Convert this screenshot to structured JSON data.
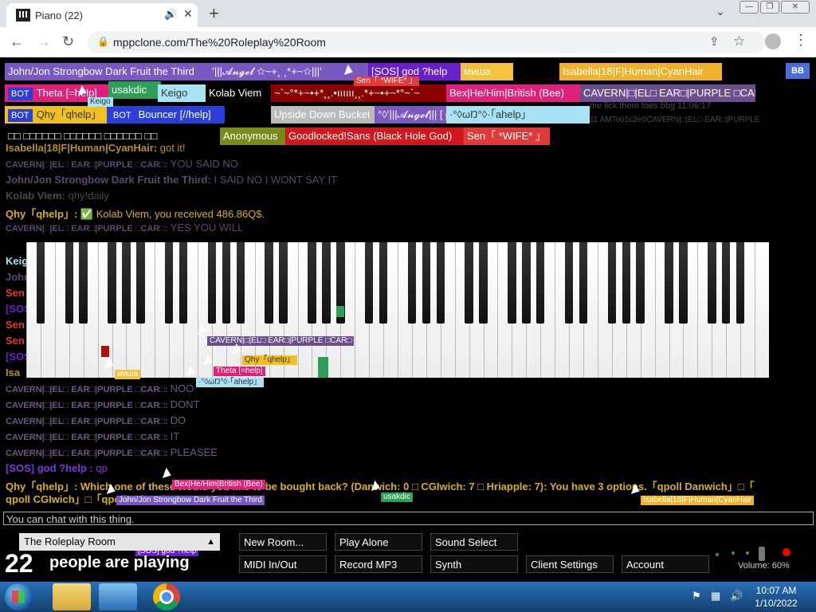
{
  "browser": {
    "tab_title": "Piano (22)",
    "url": "mppclone.com/The%20Roleplay%20Room"
  },
  "participants": [
    {
      "label": "John/Jon Strongbow Dark Fruit the Third",
      "bg": "#7a58c2",
      "fg": "#ffffff"
    },
    {
      "label": "ʻ|||𝓐𝓷𝓰𝓮𝓵 ☆~+¸ ¸*+~☆|||ʻ",
      "bg": "#7a58c2",
      "fg": "#ffffff"
    },
    {
      "label": "[SOS] god ?help",
      "bg": "#6a1fcc",
      "fg": "#ffffff"
    },
    {
      "label": "миша",
      "bg": "#f3c13a",
      "fg": "#ffffff"
    },
    {
      "label": "Isabella|18|F|Human|CyanHair",
      "bg": "#f0b22a",
      "fg": "#ffffff"
    },
    {
      "label": "Theta [=help]",
      "bg": "#e0207a",
      "fg": "#ffffff",
      "bot": true
    },
    {
      "label": "usakdic",
      "bg": "#2e9e58",
      "fg": "#ffffff"
    },
    {
      "label": "Keigo",
      "bg": "#a8e2f5",
      "fg": "#333333"
    },
    {
      "label": "Kolab Viem",
      "bg": "#000000",
      "fg": "#ffffff"
    },
    {
      "label": "~`~°*+~•+*¸¸.•ıııııı¸¸.*+~•+~*°~`~",
      "bg": "#8b0000",
      "fg": "#ffffff"
    },
    {
      "label": "Bex|He/Him|British (Bee)",
      "bg": "#e0207a",
      "fg": "#ffffff"
    },
    {
      "label": "CAVERN|□|EL□ EAR□|PURPLE □CAR□",
      "bg": "#6b4f8c",
      "fg": "#ffffff"
    },
    {
      "label": "Qhy「qhelp」",
      "bg": "#f0c020",
      "fg": "#333333",
      "bot": true
    },
    {
      "label": "Bouncer [//help]",
      "bg": "#2a3fd6",
      "fg": "#ffffff",
      "bot": true
    },
    {
      "label": "Upside Down Bucket",
      "bg": "#bbbbbb",
      "fg": "#ffffff"
    },
    {
      "label": "°◊ʻ|||𝓐𝓷𝓰𝓮𝓵||| [🔒]",
      "bg": "#7a58c2",
      "fg": "#ffffff"
    },
    {
      "label": "·°◊ωŊ°◊·「ahelp」",
      "bg": "#a8e2f5",
      "fg": "#333333"
    },
    {
      "label": "□□ □□□□□□ □□□□□□ □□□□□□ □□",
      "bg": "#000000",
      "fg": "#ffffff"
    },
    {
      "label": "Anonymous",
      "bg": "#7a8a1a",
      "fg": "#ffffff"
    },
    {
      "label": "Goodlocked!Sans (Black Hole God)",
      "bg": "#d2181e",
      "fg": "#ffffff"
    },
    {
      "label": "Sen「 *WIFE* 」",
      "bg": "#e03a3a",
      "fg": "#ffffff"
    }
  ],
  "toolbar_chip": "BB",
  "chat": [
    {
      "name": "Isabella|18|F|Human|CyanHair:",
      "text": "got it!",
      "color": "#b5902a"
    },
    {
      "name": "CAVERN|□|EL□ EAR□|PURPLE □CAR□:",
      "text": "YOU SAID NO",
      "color": "#5a4a6e",
      "sc": true
    },
    {
      "name": "John/Jon Strongbow Dark Fruit the Third:",
      "text": "I SAID NO I WONT SAY IT",
      "color": "#5a4a6e"
    },
    {
      "name": "Kolab Viem:",
      "text": "qhy!daily",
      "color": "#4a4a4a"
    },
    {
      "name": "Qhy「qhelp」:",
      "text": "✅ Kolab Viem, you received 486.86Q$.",
      "color": "#d8b020"
    },
    {
      "name": "CAVERN|□|EL□ EAR□|PURPLE □CAR□:",
      "text": "YES YOU WILL",
      "color": "#5a4a6e",
      "sc": true
    }
  ],
  "chat_lower": [
    {
      "name": "CAVERN|□|EL□ EAR□|PURPLE □CAR□:",
      "text": "NOO",
      "color": "#6b5a80",
      "sc": true
    },
    {
      "name": "CAVERN|□|EL□ EAR□|PURPLE □CAR□:",
      "text": "DONT",
      "color": "#6b5a80",
      "sc": true
    },
    {
      "name": "CAVERN|□|EL□ EAR□|PURPLE □CAR□:",
      "text": "DO",
      "color": "#6b5a80",
      "sc": true
    },
    {
      "name": "CAVERN|□|EL□ EAR□|PURPLE □CAR□:",
      "text": "IT",
      "color": "#6b5a80",
      "sc": true
    },
    {
      "name": "CAVERN|□|EL□ EAR□|PURPLE □CAR□:",
      "text": "PLEASEE",
      "color": "#6b5a80",
      "sc": true
    },
    {
      "name": "[SOS] god ?help :",
      "text": "qp",
      "color": "#7a3ad8"
    },
    {
      "name": "Qhy「qhelp」:",
      "text": "Which one of these would you like to be bought back? (Danwich: 0 □ CGIwich: 7 □ Hriapple: 7): You have 3 options.「qpoll Danwich」□「",
      "color": "#d8b020"
    }
  ],
  "chat_wrap": "qpoll CGIwich」□「qpoll Hriapple」",
  "chat_fragments": [
    "Keig",
    "John",
    "Sen",
    "[SOS",
    "Sen",
    "Sen",
    "[SOS",
    "Isa"
  ],
  "ghost_text": {
    "line1": "me lick them toes bbg 11:06:17",
    "line2": "11 AMTo01c2e0CAVERN|□|EL□ EAR□|PURPLE"
  },
  "cursor_labels": [
    {
      "label": "Keigo",
      "bg": "#a8e2f5",
      "fg": "#333333"
    },
    {
      "label": "Sen「 *WIFE* 」",
      "bg": "#e03a3a",
      "fg": "#ffffff"
    },
    {
      "label": "CAVERN|□|EL□ EAR□|PURPLE □CAR□",
      "bg": "#6b4f8c",
      "fg": "#ffffff"
    },
    {
      "label": "Qhy「qhelp」",
      "bg": "#f0c020",
      "fg": "#333333"
    },
    {
      "label": "Theta [=help]",
      "bg": "#e0207a",
      "fg": "#ffffff"
    },
    {
      "label": "·°◊ωŊ°◊·「ahelp」",
      "bg": "#a8e2f5",
      "fg": "#333333"
    },
    {
      "label": "миша",
      "bg": "#f3c13a",
      "fg": "#ffffff"
    },
    {
      "label": "Bex|He/Him|British (Bee)",
      "bg": "#e0207a",
      "fg": "#ffffff"
    },
    {
      "label": "John/Jon Strongbow Dark Fruit the Third",
      "bg": "#7a58c2",
      "fg": "#ffffff"
    },
    {
      "label": "usakdic",
      "bg": "#2e9e58",
      "fg": "#ffffff"
    },
    {
      "label": "Isabella|18|F|Human|CyanHair",
      "bg": "#f0b22a",
      "fg": "#ffffff"
    },
    {
      "label": "[SOS] god ?help",
      "bg": "#6a1fcc",
      "fg": "#ffffff"
    }
  ],
  "chat_placeholder": "You can chat with this thing.",
  "room": {
    "name": "The Roleplay Room"
  },
  "people_count": "22",
  "people_label": "people are playing",
  "buttons": [
    "New Room...",
    "Play Alone",
    "Sound Select",
    "MIDI In/Out",
    "Record MP3",
    "Synth",
    "Client Settings",
    "Account"
  ],
  "volume": "Volume: 60%",
  "taskbar": {
    "time": "10:07 AM",
    "date": "1/10/2022"
  },
  "colors": {
    "pressed_red": "#b01010",
    "pressed_green": "#2e9e58"
  }
}
